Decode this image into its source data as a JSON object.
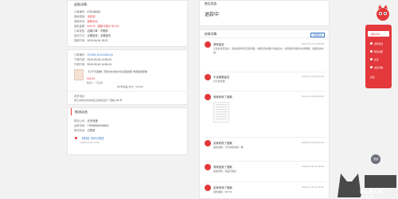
{
  "left": {
    "header_title": "退款详情",
    "info": [
      {
        "k": "订单编号：",
        "v": "579148283"
      },
      {
        "k": "退款原因：",
        "v": "未收到"
      },
      {
        "k": "退款状态：",
        "v": "退款成功"
      },
      {
        "k": "退款金额：",
        "v": "¥18.90（退款中部分 ¥0.00）"
      },
      {
        "k": "订单类型：",
        "v": "店铺订单 · 不限制"
      },
      {
        "k": "退货方式：",
        "v": "无需退货，无需退货"
      },
      {
        "k": "退款时间：",
        "v": "2019-04-04 18:21"
      }
    ],
    "order": [
      {
        "k": "订单编号：",
        "v": "201904-191102451(2)"
      },
      {
        "k": "下单时间：",
        "v": "2019-04-26 14:50:24"
      },
      {
        "k": "付款时间：",
        "v": "2019-09-18 14:51:24"
      }
    ],
    "product_title": "【小于不回收】高性价比零食大礼包混合装 零食组合套餐",
    "product_price": "¥18.90",
    "product_meta": "数量 1 · 已签收",
    "product_footer": "共1件商品   合计：¥18.90",
    "address_label": "收货地址",
    "address_text": "浙江省杭州市余杭区五常街道文一西路 998 号",
    "logistics_title": "物流动态",
    "logistics": [
      {
        "k": "物流公司：",
        "v": "天天快递"
      },
      {
        "k": "运单号码：",
        "v": "779989450006691"
      },
      {
        "k": "物流状态：",
        "v": "已签收"
      }
    ],
    "logistics_latest": "【揽收】快件已揽收",
    "logistics_latest_time": "2019-04-05 12:50"
  },
  "right": {
    "status_label": "售后状态",
    "status_text": "退款中",
    "flow_title": "协商详情",
    "flow_more": "查看更多",
    "entries": [
      {
        "name": "商家留言",
        "time": "2019-12-21 23:56:08",
        "body": "亲爱的买家您好，您的退款申请已经处理，请留意您的账户资金变动，如有疑问请联系在线客服，感谢您的支持。"
      },
      {
        "name": "平台客服留言",
        "time": "2019-10-16 20:46:06",
        "body": "已为您处理"
      },
      {
        "name": "商家修改了退款",
        "time": "2019-10-16 20:46:02",
        "body": ""
      },
      {
        "name": "买家修改了退款",
        "time": "2019-10-16 20:46:00",
        "body": "退款说明：已与商家协商一致"
      },
      {
        "name": "商家拒绝了退款",
        "time": "2019-10-11 12:45:20",
        "body": "拒绝原因：商品已发货"
      },
      {
        "name": "买家申请了退款",
        "time": "2019-10-11 12:45:10",
        "body": "退款金额：¥18.90"
      }
    ]
  },
  "sidebar": {
    "items": [
      "我的订单",
      "退款售后",
      "联系客服",
      "投诉",
      "常见问题",
      "反馈"
    ],
    "up_label": "顶部"
  },
  "watermark": {
    "text": "BLACK CAT"
  },
  "colors": {
    "accent": "#e4393c",
    "link": "#3a78c9"
  }
}
